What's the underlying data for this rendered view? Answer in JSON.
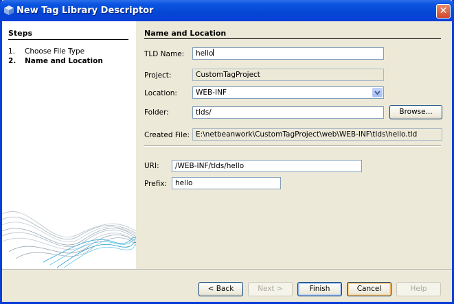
{
  "window": {
    "title": "New Tag Library Descriptor",
    "close_glyph": "✕"
  },
  "steps": {
    "title": "Steps",
    "items": [
      {
        "num": "1.",
        "label": "Choose File Type"
      },
      {
        "num": "2.",
        "label": "Name and Location"
      }
    ]
  },
  "panel": {
    "title": "Name and Location",
    "tld_name_label": "TLD Name:",
    "tld_name_value": "hello",
    "project_label": "Project:",
    "project_value": "CustomTagProject",
    "location_label": "Location:",
    "location_value": "WEB-INF",
    "folder_label": "Folder:",
    "folder_value": "tlds/",
    "browse_label": "Browse...",
    "created_file_label": "Created File:",
    "created_file_value": "E:\\netbeanwork\\CustomTagProject\\web\\WEB-INF\\tlds\\hello.tld",
    "uri_label": "URI:",
    "uri_value": "/WEB-INF/tlds/hello",
    "prefix_label": "Prefix:",
    "prefix_value": "hello"
  },
  "buttons": {
    "back": "< Back",
    "next": "Next >",
    "finish": "Finish",
    "cancel": "Cancel",
    "help": "Help"
  },
  "colors": {
    "titlebar": "#0a55e1",
    "dialog_bg": "#ece9d8",
    "accent_waves": "#2aa7d8"
  }
}
